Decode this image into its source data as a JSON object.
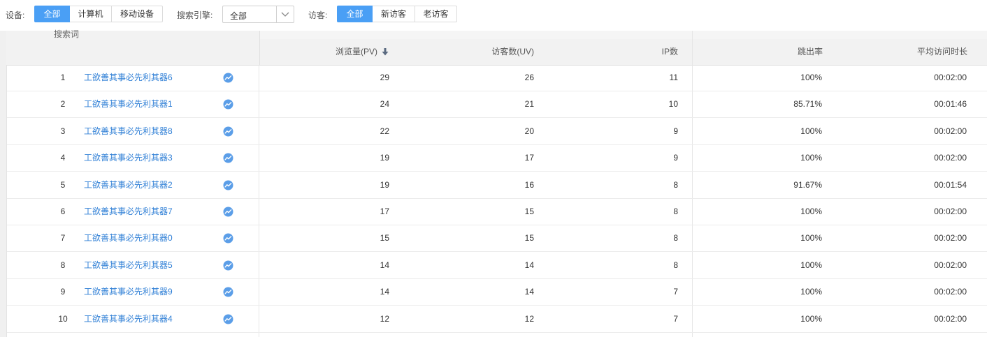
{
  "filters": {
    "device": {
      "label": "设备:",
      "options": [
        "全部",
        "计算机",
        "移动设备"
      ],
      "selected": 0
    },
    "search_engine": {
      "label": "搜索引擎:",
      "value": "全部"
    },
    "visitor": {
      "label": "访客:",
      "options": [
        "全部",
        "新访客",
        "老访客"
      ],
      "selected": 0
    }
  },
  "table": {
    "headers": {
      "keyword": "搜索词",
      "pv": "浏览量(PV)",
      "uv": "访客数(UV)",
      "ip": "IP数",
      "bounce": "跳出率",
      "avg_time": "平均访问时长"
    },
    "sort": {
      "column": "pv",
      "direction": "desc",
      "icon": "arrow-down-icon"
    },
    "rows": [
      {
        "rank": "1",
        "keyword": "工欲善其事必先利其器6",
        "pv": "29",
        "uv": "26",
        "ip": "11",
        "bounce": "100%",
        "avg_time": "00:02:00"
      },
      {
        "rank": "2",
        "keyword": "工欲善其事必先利其器1",
        "pv": "24",
        "uv": "21",
        "ip": "10",
        "bounce": "85.71%",
        "avg_time": "00:01:46"
      },
      {
        "rank": "3",
        "keyword": "工欲善其事必先利其器8",
        "pv": "22",
        "uv": "20",
        "ip": "9",
        "bounce": "100%",
        "avg_time": "00:02:00"
      },
      {
        "rank": "4",
        "keyword": "工欲善其事必先利其器3",
        "pv": "19",
        "uv": "17",
        "ip": "9",
        "bounce": "100%",
        "avg_time": "00:02:00"
      },
      {
        "rank": "5",
        "keyword": "工欲善其事必先利其器2",
        "pv": "19",
        "uv": "16",
        "ip": "8",
        "bounce": "91.67%",
        "avg_time": "00:01:54"
      },
      {
        "rank": "6",
        "keyword": "工欲善其事必先利其器7",
        "pv": "17",
        "uv": "15",
        "ip": "8",
        "bounce": "100%",
        "avg_time": "00:02:00"
      },
      {
        "rank": "7",
        "keyword": "工欲善其事必先利其器0",
        "pv": "15",
        "uv": "15",
        "ip": "8",
        "bounce": "100%",
        "avg_time": "00:02:00"
      },
      {
        "rank": "8",
        "keyword": "工欲善其事必先利其器5",
        "pv": "14",
        "uv": "14",
        "ip": "8",
        "bounce": "100%",
        "avg_time": "00:02:00"
      },
      {
        "rank": "9",
        "keyword": "工欲善其事必先利其器9",
        "pv": "14",
        "uv": "14",
        "ip": "7",
        "bounce": "100%",
        "avg_time": "00:02:00"
      },
      {
        "rank": "10",
        "keyword": "工欲善其事必先利其器4",
        "pv": "12",
        "uv": "12",
        "ip": "7",
        "bounce": "100%",
        "avg_time": "00:02:00"
      }
    ]
  },
  "colors": {
    "accent": "#4a9ff5",
    "link": "#2f7fd6",
    "trend_icon": "#5b9ee8"
  }
}
